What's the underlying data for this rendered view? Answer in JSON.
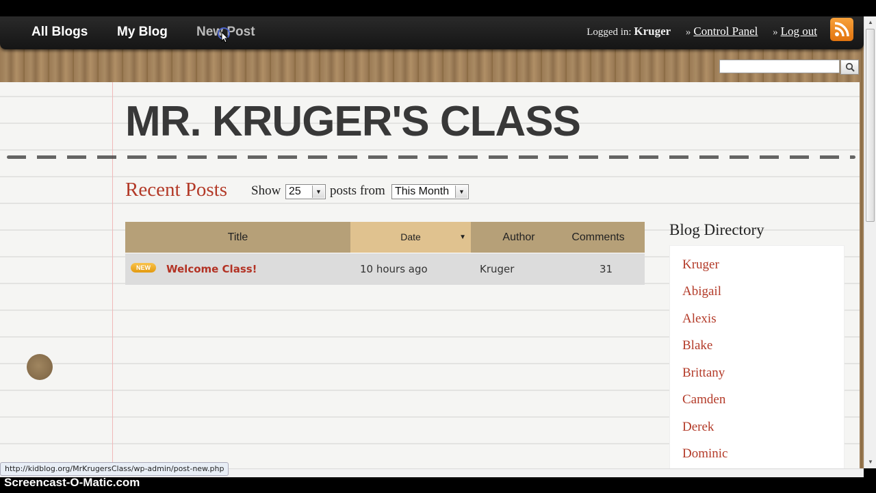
{
  "navbar": {
    "all_blogs": "All Blogs",
    "my_blog": "My Blog",
    "new_post": "New Post",
    "logged_in_label": "Logged in:",
    "username": "Kruger",
    "raquo": "»",
    "control_panel": "Control Panel",
    "log_out": "Log out",
    "rss_icon": "rss-feed-icon"
  },
  "search": {
    "value": "",
    "icon": "magnifier-icon"
  },
  "site": {
    "title": "MR. KRUGER'S CLASS"
  },
  "recent_posts": {
    "heading": "Recent Posts",
    "show_label": "Show",
    "count_value": "25",
    "posts_from_label": "posts from",
    "period_value": "This Month"
  },
  "posts_table": {
    "columns": [
      "Title",
      "Date",
      "Author",
      "Comments"
    ],
    "sort_indicator": "▼",
    "rows": [
      {
        "badge": "NEW",
        "title": "Welcome Class!",
        "date": "10 hours ago",
        "author": "Kruger",
        "comments": "31"
      }
    ]
  },
  "directory": {
    "heading": "Blog Directory",
    "items": [
      "Kruger",
      "Abigail",
      "Alexis",
      "Blake",
      "Brittany",
      "Camden",
      "Derek",
      "Dominic"
    ]
  },
  "status_bar": {
    "url": "http://kidblog.org/MrKrugersClass/wp-admin/post-new.php"
  },
  "watermark": "Screencast-O-Matic.com",
  "colors": {
    "accent_red": "#b33a28",
    "header_tan": "#b6a078",
    "date_header": "#e0c28f",
    "rss_orange": "#f08a1e"
  }
}
